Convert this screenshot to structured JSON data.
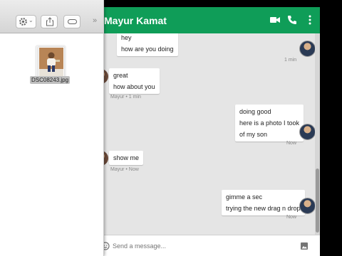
{
  "chat": {
    "contact_name": "Mayur Kamat",
    "header_icons": [
      "video-icon",
      "phone-icon",
      "more-icon"
    ],
    "header_color": "#0f9d58",
    "compose_placeholder": "Send a message...",
    "messages": [
      {
        "side": "self",
        "lines": [
          "hey",
          "how are you doing"
        ],
        "meta": "1 min"
      },
      {
        "side": "other",
        "lines": [
          "great",
          "how about you"
        ],
        "meta": "Mayur • 1 min"
      },
      {
        "side": "self",
        "lines": [
          "doing good",
          "here is a photo I took",
          "of my son"
        ],
        "meta": "Now"
      },
      {
        "side": "other",
        "lines": [
          "show me"
        ],
        "meta": "Mayur • Now"
      },
      {
        "side": "self",
        "lines": [
          "gimme a sec",
          "trying the new drag n drop"
        ],
        "meta": "Now"
      }
    ]
  },
  "finder": {
    "toolbar_icons": [
      "gear-icon",
      "share-icon",
      "tag-icon",
      "overflow-icon"
    ],
    "overflow_glyph": "»",
    "dropdown_glyph": "⌄",
    "file_name": "DSC08243.jpg"
  }
}
